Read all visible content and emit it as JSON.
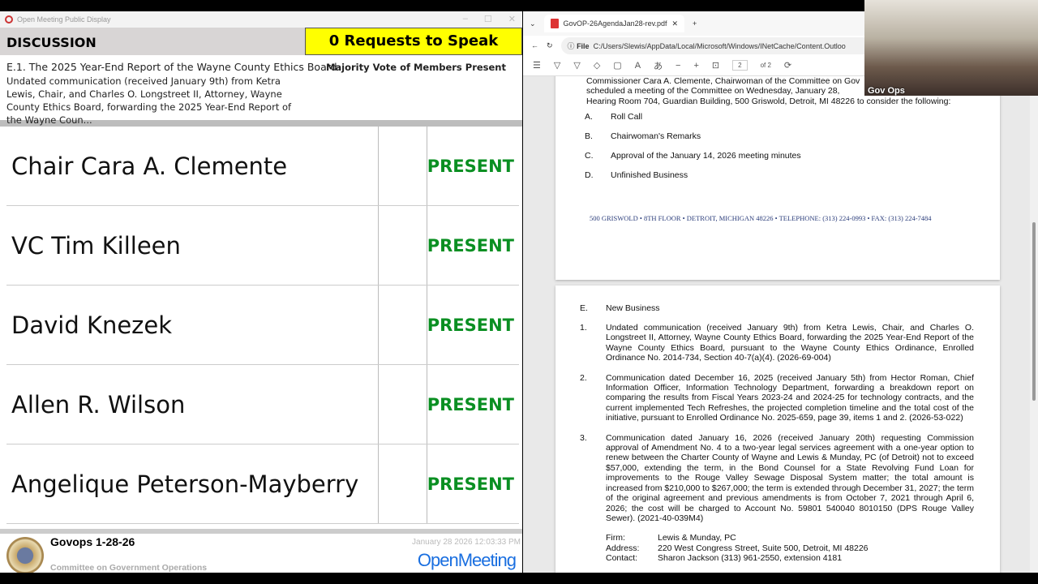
{
  "left_app": {
    "window_title": "Open Meeting Public Display",
    "section": "DISCUSSION",
    "requests": "0 Requests to Speak",
    "item_title": "E.1. The 2025 Year-End Report of the Wayne County Ethics Board",
    "item_desc": "Undated communication (received January 9th) from Ketra Lewis, Chair, and Charles O. Longstreet II, Attorney, Wayne County Ethics Board, forwarding the 2025 Year-End Report of the Wayne Coun...",
    "vote_type": "Majority Vote of Members Present",
    "roster": [
      {
        "name": "Chair Cara A. Clemente",
        "status": "PRESENT"
      },
      {
        "name": "VC Tim Killeen",
        "status": "PRESENT"
      },
      {
        "name": "David  Knezek",
        "status": "PRESENT"
      },
      {
        "name": "Allen R. Wilson",
        "status": "PRESENT"
      },
      {
        "name": "Angelique Peterson-Mayberry",
        "status": "PRESENT"
      }
    ],
    "footer": {
      "title": "Govops 1-28-26",
      "subtitle": "Committee on Government Operations",
      "datetime": "January 28 2026 12:03:33 PM",
      "brand": "OpenMeeting"
    }
  },
  "browser": {
    "tab": "GovOP-26AgendaJan28-rev.pdf",
    "url_label": "File",
    "url": "C:/Users/Slewis/AppData/Local/Microsoft/Windows/INetCache/Content.Outloo",
    "page": "2",
    "page_of": "of 2",
    "pdf": {
      "intro": [
        "Commissioner Cara A. Clemente, Chairwoman of the Committee on Gov",
        "scheduled a meeting of the Committee on Wednesday, January 28,",
        "Hearing Room 704, Guardian Building, 500 Griswold, Detroit, MI 48226 to consider the following:"
      ],
      "agenda": [
        {
          "l": "A.",
          "t": "Roll Call"
        },
        {
          "l": "B.",
          "t": "Chairwoman's Remarks"
        },
        {
          "l": "C.",
          "t": "Approval of the January 14, 2026 meeting minutes"
        },
        {
          "l": "D.",
          "t": "Unfinished Business"
        }
      ],
      "address": "500 GRISWOLD • 8TH FLOOR • DETROIT, MICHIGAN 48226 • TELEPHONE: (313) 224-0993 • FAX: (313) 224-7484",
      "new_business_l": "E.",
      "new_business": "New Business",
      "items": [
        {
          "n": "1.",
          "t": "Undated communication (received January 9th) from Ketra Lewis, Chair, and Charles O. Longstreet II, Attorney, Wayne County Ethics Board, forwarding the 2025 Year-End Report of the Wayne County Ethics Board, pursuant to the Wayne County Ethics Ordinance, Enrolled Ordinance No. 2014-734, Section 40-7(a)(4). (2026-69-004)"
        },
        {
          "n": "2.",
          "t": "Communication dated December 16, 2025 (received January 5th) from Hector Roman, Chief Information Officer, Information Technology Department, forwarding a breakdown report on comparing the results from Fiscal Years 2023-24 and 2024-25 for technology contracts, and the current implemented Tech Refreshes, the projected completion timeline and the total cost of the initiative, pursuant to Enrolled Ordinance No. 2025-659, page 39, items 1 and 2. (2026-53-022)"
        },
        {
          "n": "3.",
          "t": "Communication dated January 16, 2026 (received January 20th) requesting Commission approval of Amendment No. 4 to a two-year legal services agreement with a one-year option to renew between the Charter County of Wayne and Lewis & Munday, PC (of Detroit) not to exceed $57,000, extending the term, in the Bond Counsel for a State Revolving Fund Loan for improvements to the Rouge Valley Sewage Disposal System matter; the total amount is increased from $210,000 to $267,000; the term is extended through December 31, 2027; the term of the original agreement and previous amendments is from October 7, 2021 through April 6, 2026; the cost will be charged to Account No. 59801 540040 8010150 (DPS Rouge Valley Sewer). (2021-40-039M4)"
        }
      ],
      "contact": [
        {
          "k": "Firm:",
          "v": "Lewis & Munday, PC"
        },
        {
          "k": "Address:",
          "v": "220 West Congress Street, Suite 500, Detroit, MI 48226"
        },
        {
          "k": "Contact:",
          "v": "Sharon Jackson (313) 961-2550, extension 4181"
        }
      ]
    }
  },
  "video": {
    "caption": "Gov Ops"
  }
}
